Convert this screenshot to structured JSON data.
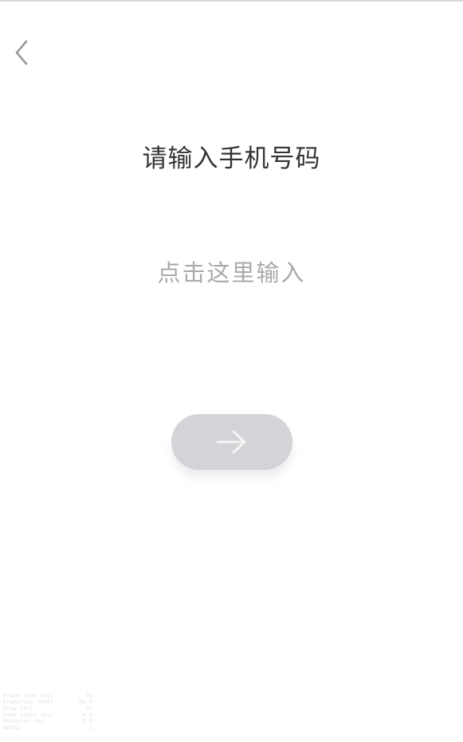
{
  "header": {
    "back_icon": "chevron-left-icon"
  },
  "main": {
    "title": "请输入手机号码",
    "phone_input": {
      "value": "",
      "placeholder": "点击这里输入"
    },
    "next_button": {
      "icon": "arrow-right-icon",
      "state": "disabled"
    }
  },
  "debug_overlay": {
    "rows": [
      {
        "label": "Frame time (ms)",
        "value": "10"
      },
      {
        "label": "Framerate (FPS)",
        "value": "64.0"
      },
      {
        "label": "Draw call",
        "value": "12"
      },
      {
        "label": "Game Logic (ms)",
        "value": "4.0"
      },
      {
        "label": "Renderer (ms)",
        "value": "1.0"
      },
      {
        "label": "WebGL",
        "value": "1"
      }
    ]
  },
  "colors": {
    "title_text": "#333333",
    "placeholder_text": "#aaaaaa",
    "button_disabled_bg": "#d4d3d7",
    "button_arrow": "#f5f5f5",
    "back_icon": "#999999"
  }
}
